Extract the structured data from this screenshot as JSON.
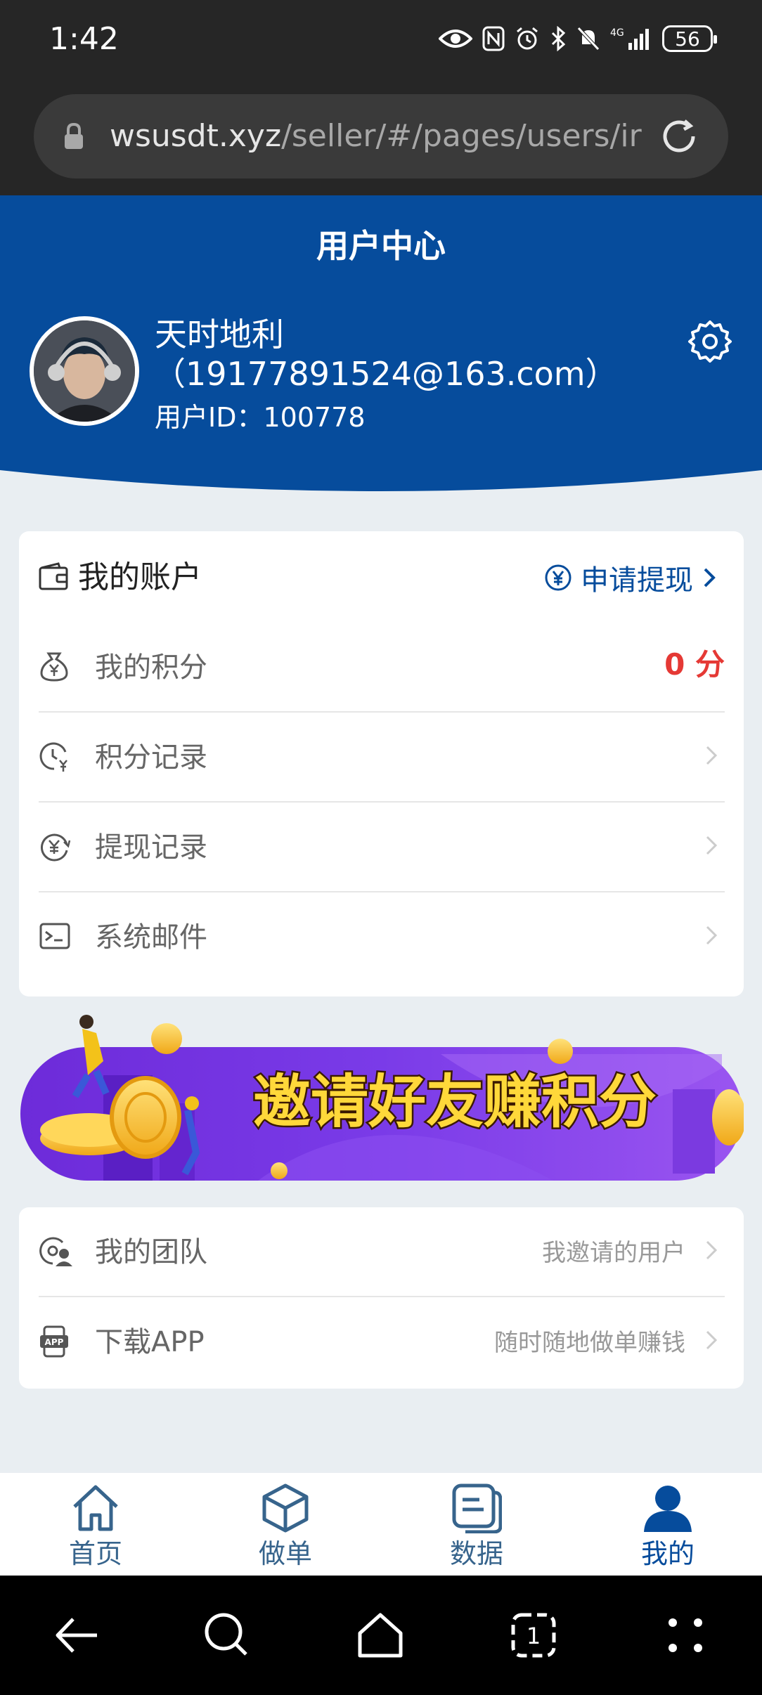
{
  "status_bar": {
    "time": "1:42",
    "network": "4G",
    "battery": "56"
  },
  "browser": {
    "url_host": "wsusdt.xyz",
    "url_path": "/seller/#/pages/users/ir"
  },
  "header": {
    "title": "用户中心",
    "user_name": "天时地利",
    "user_email": "（19177891524@163.com）",
    "user_id_label": "用户ID：",
    "user_id": "100778"
  },
  "account": {
    "title": "我的账户",
    "withdraw_label": "申请提现",
    "rows": [
      {
        "label": "我的积分",
        "value": "0 分"
      },
      {
        "label": "积分记录"
      },
      {
        "label": "提现记录"
      },
      {
        "label": "系统邮件"
      }
    ]
  },
  "banner": {
    "text": "邀请好友赚积分"
  },
  "more": {
    "rows": [
      {
        "label": "我的团队",
        "hint": "我邀请的用户"
      },
      {
        "label": "下载APP",
        "hint": "随时随地做单赚钱"
      }
    ]
  },
  "bottom_nav": [
    {
      "label": "首页",
      "icon": "home-icon"
    },
    {
      "label": "做单",
      "icon": "box-icon"
    },
    {
      "label": "数据",
      "icon": "data-icon"
    },
    {
      "label": "我的",
      "icon": "user-icon",
      "active": true
    }
  ],
  "colors": {
    "primary": "#064c9c",
    "points": "#e53935",
    "background": "#e9eef2"
  }
}
